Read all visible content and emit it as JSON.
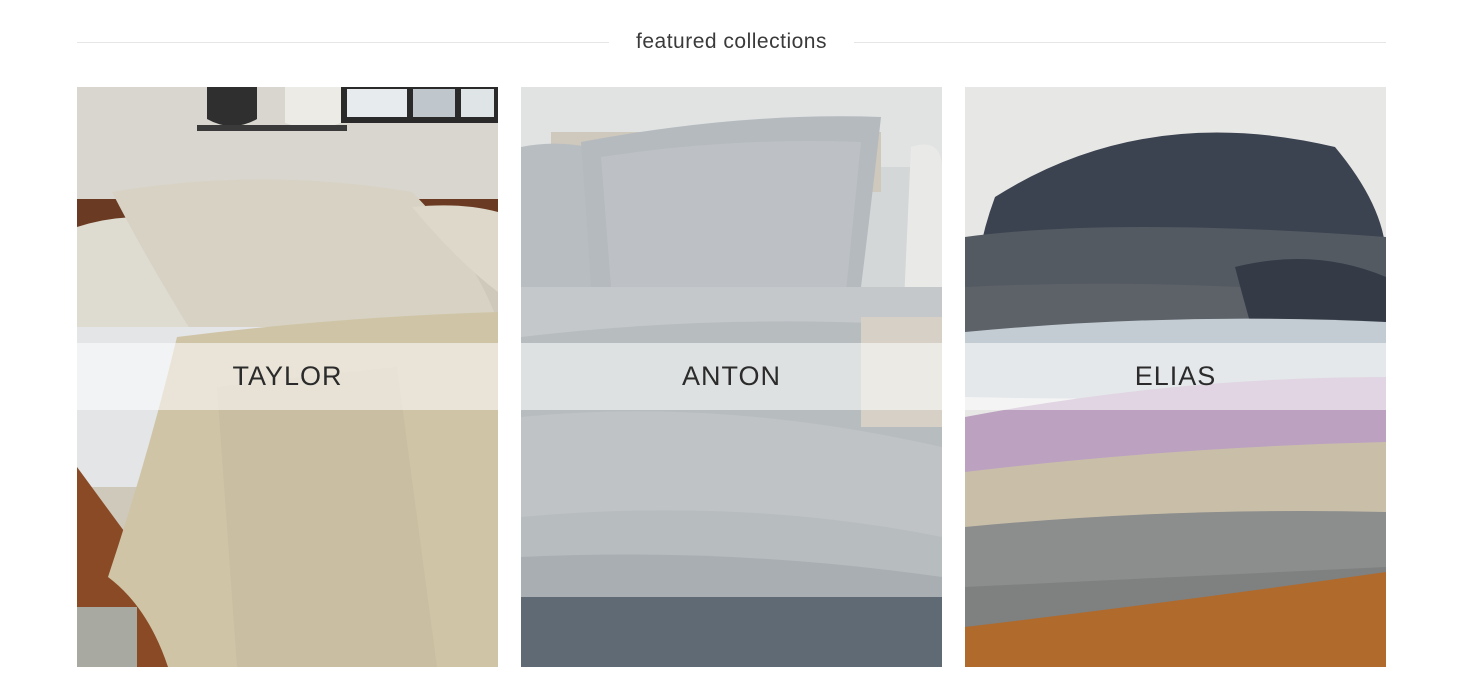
{
  "section": {
    "title": "featured collections"
  },
  "collections": [
    {
      "label": "TAYLOR",
      "image": "beige-linen-bedding-photo"
    },
    {
      "label": "ANTON",
      "image": "grey-percale-bedding-photo"
    },
    {
      "label": "ELIAS",
      "image": "folded-linen-throws-photo"
    }
  ],
  "colors": {
    "text": "#2b2b2b",
    "divider": "#e6e6e6",
    "label_band": "rgba(255,255,255,0.55)"
  }
}
